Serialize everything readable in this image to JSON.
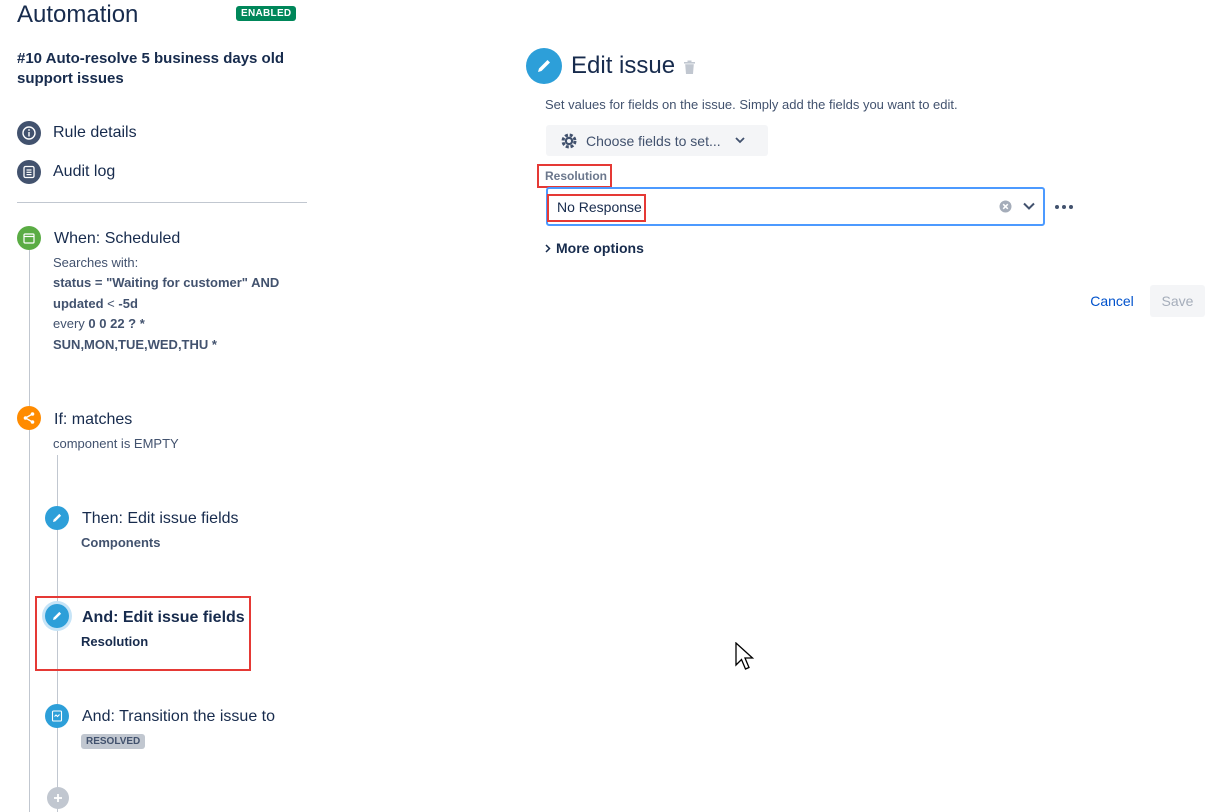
{
  "app": {
    "title": "Automation",
    "status_badge": "ENABLED"
  },
  "rule": {
    "name": "#10 Auto-resolve 5 business days old support issues"
  },
  "nav": [
    {
      "label": "Rule details",
      "icon": "info-icon"
    },
    {
      "label": "Audit log",
      "icon": "list-icon"
    }
  ],
  "steps": {
    "trigger": {
      "title": "When: Scheduled",
      "searches_label": "Searches with:",
      "jql_line1_bold": "status",
      "jql_line1_rest": " = \"Waiting for customer\" AND",
      "jql_line2_bold": "updated",
      "jql_line2_rest": " < -5d",
      "every_label": "every",
      "cron_part1": "0 0 22 ? *",
      "cron_part2": "SUN,MON,TUE,WED,THU *"
    },
    "condition": {
      "title": "If: matches",
      "detail": "component is EMPTY"
    },
    "action1": {
      "title": "Then: Edit issue fields",
      "detail": "Components"
    },
    "action2": {
      "title": "And: Edit issue fields",
      "detail": "Resolution"
    },
    "action3": {
      "title": "And: Transition the issue to",
      "badge": "RESOLVED"
    }
  },
  "editor": {
    "title": "Edit issue",
    "description": "Set values for fields on the issue. Simply add the fields you want to edit.",
    "choose_fields_label": "Choose fields to set...",
    "field_label": "Resolution",
    "field_value": "No Response",
    "more_options_label": "More options",
    "cancel_label": "Cancel",
    "save_label": "Save"
  },
  "colors": {
    "trigger": "#5aac44",
    "condition": "#ff8b00",
    "action": "#2d9fd9",
    "enabled": "#00875a",
    "highlight": "#e53935"
  }
}
